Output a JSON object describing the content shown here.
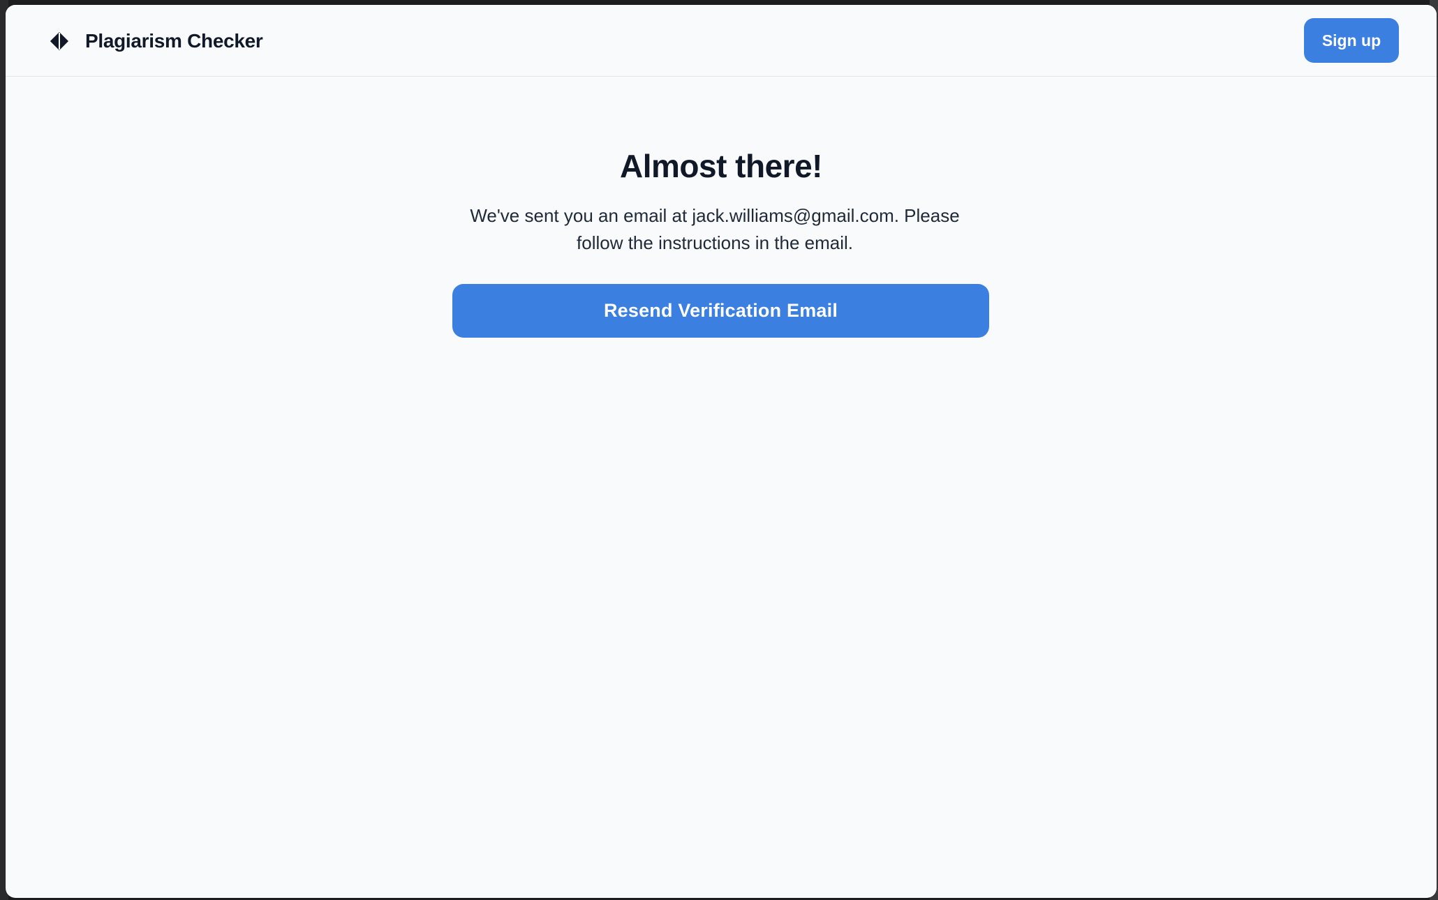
{
  "header": {
    "app_name": "Plagiarism Checker",
    "logo_icon": "diamond-icon",
    "signup_label": "Sign up"
  },
  "main": {
    "heading": "Almost there!",
    "message": "We've sent you an email at jack.williams@gmail.com. Please follow the instructions in the email.",
    "resend_label": "Resend Verification Email"
  },
  "colors": {
    "accent": "#3b7fe0",
    "background": "#f8fafc",
    "text": "#111827"
  }
}
